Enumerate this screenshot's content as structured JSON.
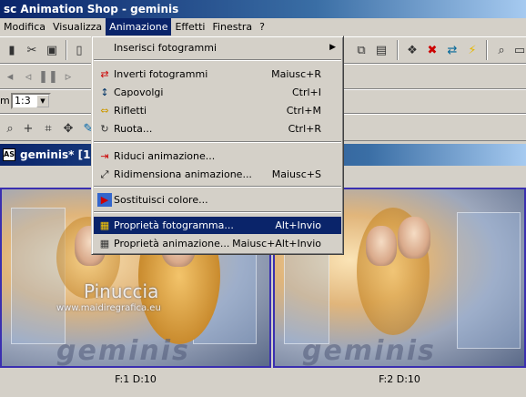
{
  "window": {
    "title": "sc Animation Shop - geminis"
  },
  "menubar": {
    "items": [
      {
        "label": "Modifica",
        "active": false
      },
      {
        "label": "Visualizza",
        "active": false
      },
      {
        "label": "Animazione",
        "active": true
      },
      {
        "label": "Effetti",
        "active": false
      },
      {
        "label": "Finestra",
        "active": false
      },
      {
        "label": "?",
        "active": false
      }
    ]
  },
  "toolbar": {
    "zoom_label": "m:",
    "zoom_value": "1:3"
  },
  "dropdown": {
    "items": [
      {
        "label": "Inserisci fotogrammi",
        "shortcut": "",
        "icon": "none",
        "submenu": true
      },
      {
        "label": "Inverti fotogrammi",
        "shortcut": "Maiusc+R",
        "icon": "reverse-frames-icon"
      },
      {
        "label": "Capovolgi",
        "shortcut": "Ctrl+I",
        "icon": "flip-icon"
      },
      {
        "label": "Rifletti",
        "shortcut": "Ctrl+M",
        "icon": "mirror-icon"
      },
      {
        "label": "Ruota...",
        "shortcut": "Ctrl+R",
        "icon": "rotate-icon"
      },
      {
        "label": "Riduci animazione...",
        "shortcut": "",
        "icon": "shrink-animation-icon"
      },
      {
        "label": "Ridimensiona animazione...",
        "shortcut": "Maiusc+S",
        "icon": "resize-animation-icon"
      },
      {
        "label": "Sostituisci colore...",
        "shortcut": "",
        "icon": "replace-color-icon"
      },
      {
        "label": "Proprietà fotogramma...",
        "shortcut": "Alt+Invio",
        "icon": "frame-properties-icon",
        "highlighted": true
      },
      {
        "label": "Proprietà animazione...",
        "shortcut": "Maiusc+Alt+Invio",
        "icon": "animation-properties-icon"
      }
    ]
  },
  "document": {
    "title": "geminis* [1:3",
    "frames": [
      {
        "label": "F:1   D:10"
      },
      {
        "label": "F:2   D:10"
      }
    ],
    "watermark_name": "Pinuccia",
    "watermark_url": "www.maidiregrafica.eu",
    "watermark_logo": "geminis"
  },
  "colors": {
    "highlight": "#0a246a",
    "frame_border": "#3a2fb0",
    "face": "#d4d0c8"
  }
}
